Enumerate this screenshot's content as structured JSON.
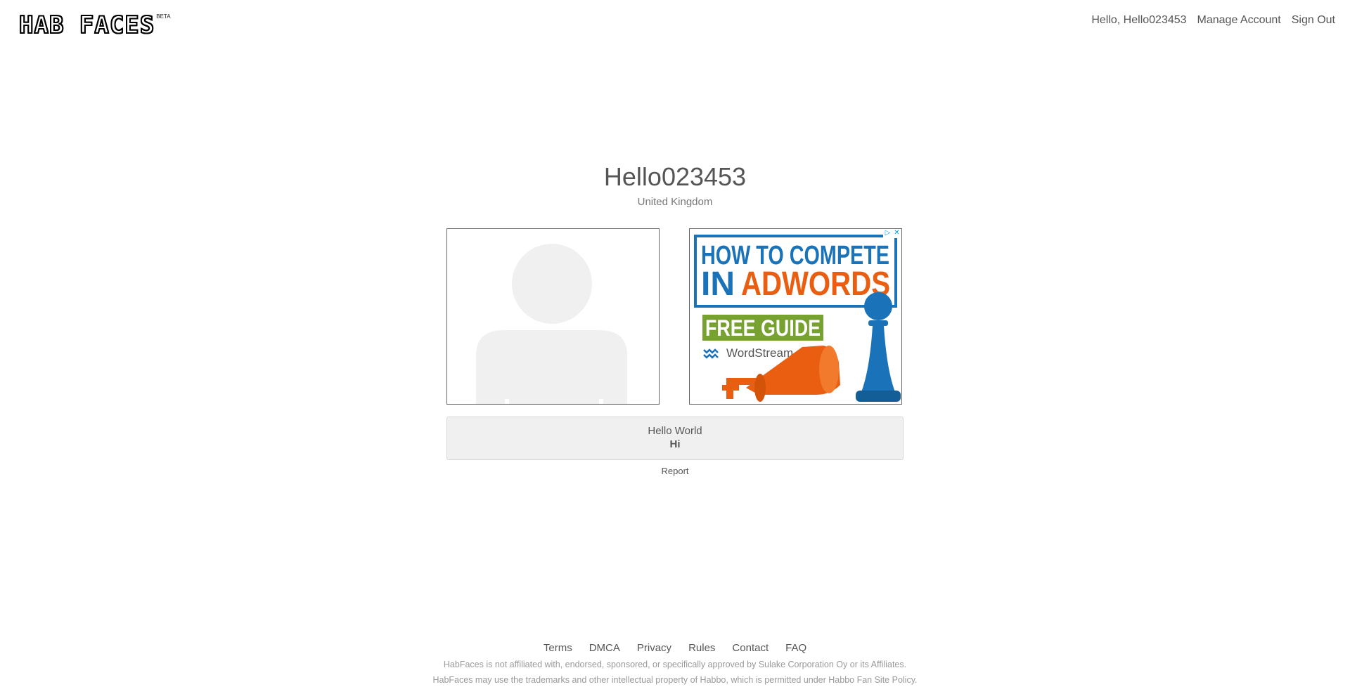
{
  "header": {
    "logo_text": "HAB FACES",
    "logo_badge": "BETA",
    "nav": {
      "greeting": "Hello, Hello023453",
      "manage_account": "Manage Account",
      "sign_out": "Sign Out"
    }
  },
  "profile": {
    "username": "Hello023453",
    "country": "United Kingdom",
    "avatar_icon": "user-placeholder-icon",
    "bio_title": "Hello World",
    "bio_text": "Hi",
    "report_label": "Report"
  },
  "ad": {
    "headline_line1": "HOW TO COMPETE",
    "headline_in": "IN",
    "headline_adwords": "ADWORDS",
    "cta": "FREE GUIDE",
    "brand": "WordStream",
    "colors": {
      "blue": "#1a73b8",
      "orange": "#e95e10",
      "green": "#78a22f"
    }
  },
  "footer": {
    "links": [
      "Terms",
      "DMCA",
      "Privacy",
      "Rules",
      "Contact",
      "FAQ"
    ],
    "disclaimer_1": "HabFaces is not affiliated with, endorsed, sponsored, or specifically approved by Sulake Corporation Oy or its Affiliates.",
    "disclaimer_2": "HabFaces may use the trademarks and other intellectual property of Habbo, which is permitted under Habbo Fan Site Policy."
  }
}
